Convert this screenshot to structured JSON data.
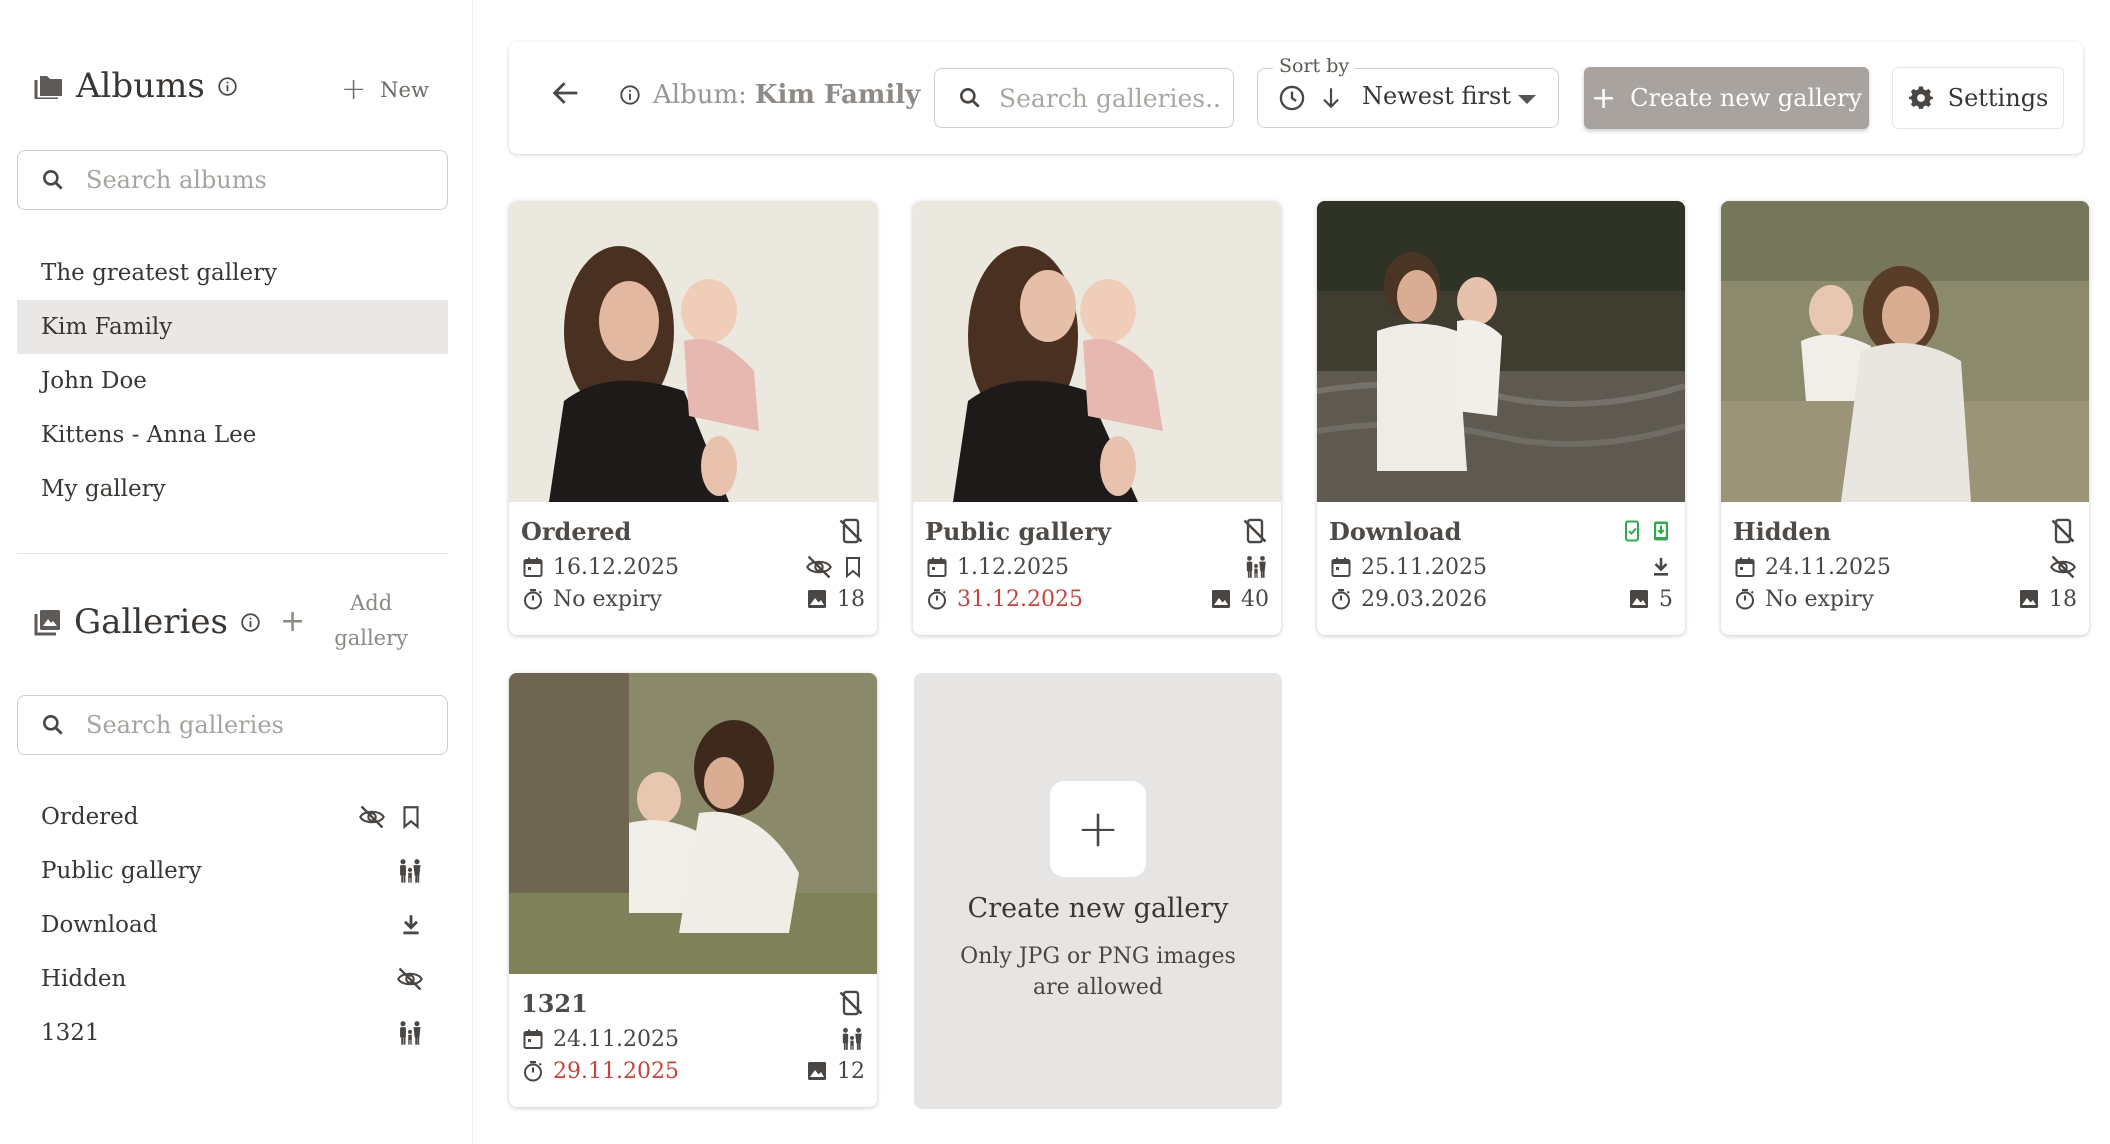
{
  "colors": {
    "accent_button": "#a8a39e",
    "active_album_bg": "#e9e8e7",
    "expired_date": "#c5453e",
    "download_icon_green": "#2fa84f"
  },
  "sidebar": {
    "albums_title": "Albums",
    "new_label": "New",
    "album_search_placeholder": "Search albums",
    "albums": [
      {
        "label": "The greatest gallery",
        "active": false
      },
      {
        "label": "Kim Family",
        "active": true
      },
      {
        "label": "John Doe",
        "active": false
      },
      {
        "label": "Kittens - Anna Lee",
        "active": false
      },
      {
        "label": "My gallery",
        "active": false
      }
    ],
    "galleries_title": "Galleries",
    "add_gallery_label": "Add gallery",
    "gallery_search_placeholder": "Search galleries",
    "galleries": [
      {
        "label": "Ordered",
        "icons": [
          "eye-off-icon",
          "bookmark-icon"
        ]
      },
      {
        "label": "Public gallery",
        "icons": [
          "family-icon"
        ]
      },
      {
        "label": "Download",
        "icons": [
          "download-icon"
        ]
      },
      {
        "label": "Hidden",
        "icons": [
          "eye-off-icon"
        ]
      },
      {
        "label": "1321",
        "icons": [
          "family-icon"
        ]
      }
    ]
  },
  "topbar": {
    "album_prefix": "Album:",
    "album_name": "Kim Family",
    "search_placeholder": "Search galleries...",
    "sort_legend": "Sort by",
    "sort_value": "Newest first",
    "create_label": "Create new gallery",
    "settings_label": "Settings"
  },
  "cards": [
    {
      "title": "Ordered",
      "date": "16.12.2025",
      "expiry": "No expiry",
      "expiry_expired": false,
      "count": "18",
      "status_icon": "no-phone-icon",
      "flags": [
        "eye-off-icon",
        "bookmark-icon"
      ]
    },
    {
      "title": "Public gallery",
      "date": "1.12.2025",
      "expiry": "31.12.2025",
      "expiry_expired": true,
      "count": "40",
      "status_icon": "no-phone-icon",
      "flags": [
        "family-icon"
      ]
    },
    {
      "title": "Download",
      "date": "25.11.2025",
      "expiry": "29.03.2026",
      "expiry_expired": false,
      "count": "5",
      "status_icon": "phone-download-icon",
      "flags": [
        "download-icon"
      ]
    },
    {
      "title": "Hidden",
      "date": "24.11.2025",
      "expiry": "No expiry",
      "expiry_expired": false,
      "count": "18",
      "status_icon": "no-phone-icon",
      "flags": [
        "eye-off-icon"
      ]
    },
    {
      "title": "1321",
      "date": "24.11.2025",
      "expiry": "29.11.2025",
      "expiry_expired": true,
      "count": "12",
      "status_icon": "no-phone-icon",
      "flags": [
        "family-icon"
      ]
    }
  ],
  "create_card": {
    "title": "Create new gallery",
    "hint": "Only JPG or PNG images are allowed"
  }
}
